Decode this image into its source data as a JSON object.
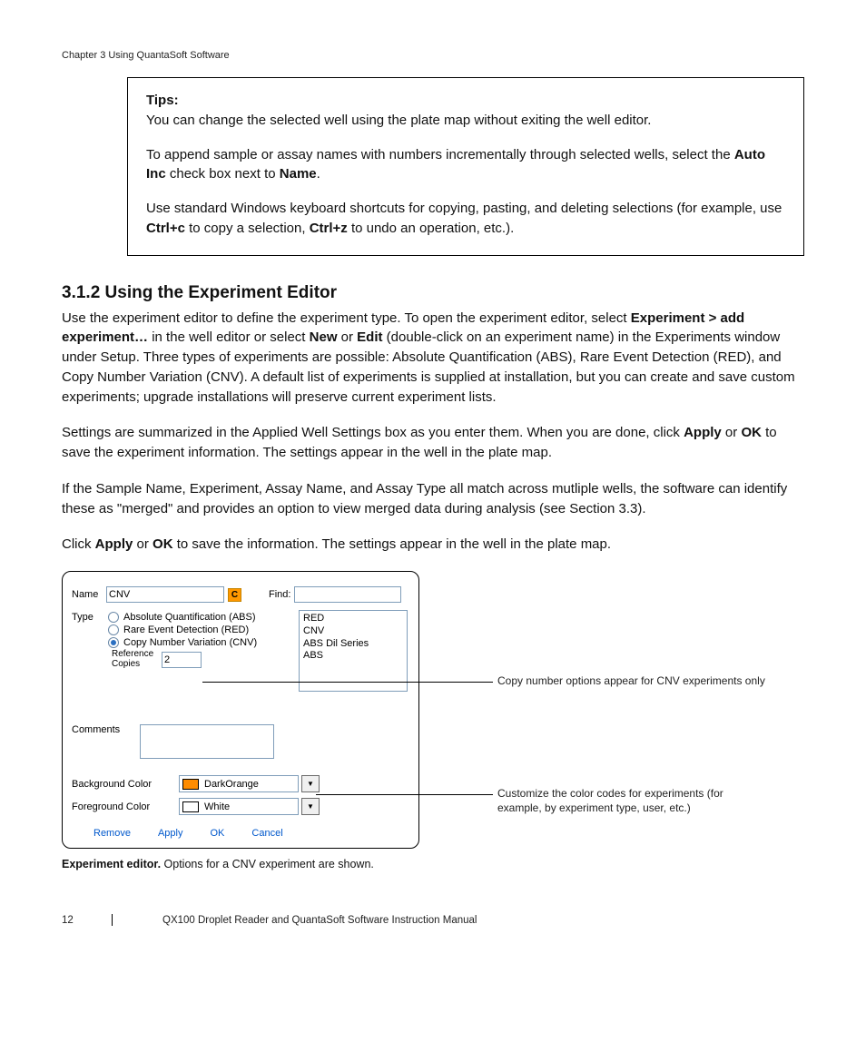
{
  "chapter": "Chapter 3 Using QuantaSoft Software",
  "tips": {
    "heading": "Tips:",
    "p1": "You can change the selected well using the plate map without exiting the well editor.",
    "p2a": "To append sample or assay names with numbers incrementally through selected wells, select the ",
    "p2b": "Auto Inc",
    "p2c": " check box next to ",
    "p2d": "Name",
    "p2e": ".",
    "p3a": "Use standard Windows keyboard shortcuts for copying, pasting, and deleting selections (for example, use ",
    "p3b": "Ctrl+c",
    "p3c": " to copy a selection, ",
    "p3d": "Ctrl+z",
    "p3e": " to undo an operation, etc.)."
  },
  "section": {
    "num_title": "3.1.2 Using the Experiment Editor",
    "p1a": "Use the experiment editor to define the experiment type. To open the experiment editor, select ",
    "p1b": "Experiment > add experiment…",
    "p1c": " in the well editor or select ",
    "p1d": "New",
    "p1e": " or ",
    "p1f": "Edit",
    "p1g": " (double-click on an experiment name) in the Experiments window under Setup. Three types of experiments are possible: Absolute Quantification (ABS), Rare Event Detection (RED), and Copy Number Variation (CNV). A default list of experiments is supplied at installation, but you can create and save custom experiments; upgrade installations will preserve current experiment lists.",
    "p2a": "Settings are summarized in the Applied Well Settings box as you enter them. When you are done, click ",
    "p2b": "Apply",
    "p2c": " or ",
    "p2d": "OK",
    "p2e": " to save the experiment information. The settings appear in the well in the plate map.",
    "p3": "If the Sample Name, Experiment, Assay Name, and Assay Type all match across mutliple wells, the software can identify these as \"merged\" and provides an option to view merged data during analysis (see Section 3.3).",
    "p4a": "Click ",
    "p4b": "Apply",
    "p4c": " or ",
    "p4d": "OK",
    "p4e": " to save the information. The settings appear in the well in the plate map."
  },
  "editor": {
    "name_label": "Name",
    "name_value": "CNV",
    "icon_c": "C",
    "find_label": "Find:",
    "type_label": "Type",
    "type_abs": "Absolute Quantification (ABS)",
    "type_red": "Rare Event Detection (RED)",
    "type_cnv": "Copy Number Variation (CNV)",
    "ref_label": "Reference Copies",
    "ref_value": "2",
    "list": {
      "i0": "RED",
      "i1": "CNV",
      "i2": "ABS Dil Series",
      "i3": "ABS"
    },
    "comments_label": "Comments",
    "bg_label": "Background Color",
    "bg_value": "DarkOrange",
    "fg_label": "Foreground Color",
    "fg_value": "White",
    "dropdown_arrow": "▼",
    "btn_remove": "Remove",
    "btn_apply": "Apply",
    "btn_ok": "OK",
    "btn_cancel": "Cancel"
  },
  "callouts": {
    "c1": "Copy number options appear for CNV experiments only",
    "c2": "Customize the color codes for experiments (for example, by experiment type, user, etc.)"
  },
  "caption": {
    "bold": "Experiment editor.",
    "rest": " Options for a CNV experiment are shown."
  },
  "footer": {
    "page": "12",
    "title": "QX100 Droplet Reader and QuantaSoft Software Instruction Manual"
  }
}
